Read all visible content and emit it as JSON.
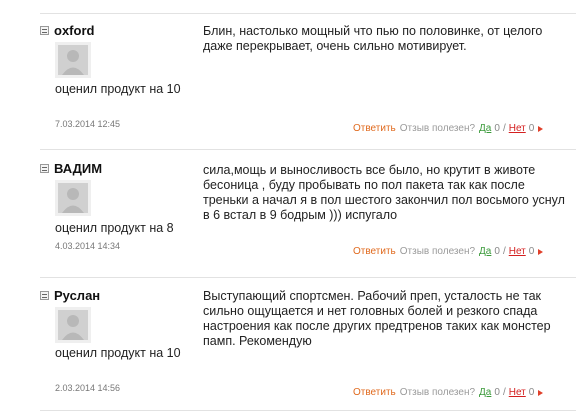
{
  "actions": {
    "reply": "Ответить",
    "useful": "Отзыв полезен?",
    "yes": "Да",
    "no": "Нет",
    "separator": "/"
  },
  "reviews": [
    {
      "author": "oxford",
      "rated": "оценил продукт на 10",
      "date": "7.03.2014 12:45",
      "text": "Блин, настолько мощный что пью по половинке, от целого даже перекрывает, очень сильно мотивирует.",
      "yes_count": "0",
      "no_count": "0"
    },
    {
      "author": "ВАДИМ",
      "rated": "оценил продукт на 8",
      "date": "4.03.2014 14:34",
      "text": "сила,мощь и выносливость все было, но крутит в животе бесоница , буду пробывать по пол пакета так как после треньки а начал я в пол шестого закончил пол восьмого уснул в 6 встал в 9 бодрым ))) испугало",
      "yes_count": "0",
      "no_count": "0"
    },
    {
      "author": "Руслан",
      "rated": "оценил продукт на 10",
      "date": "2.03.2014 14:56",
      "text": "Выступающий спортсмен. Рабочий преп, усталость не так сильно ощущается и нет головных болей и резкого спада настроения как после других предтренов таких как монстер памп. Рекомендую",
      "yes_count": "0",
      "no_count": "0"
    }
  ]
}
